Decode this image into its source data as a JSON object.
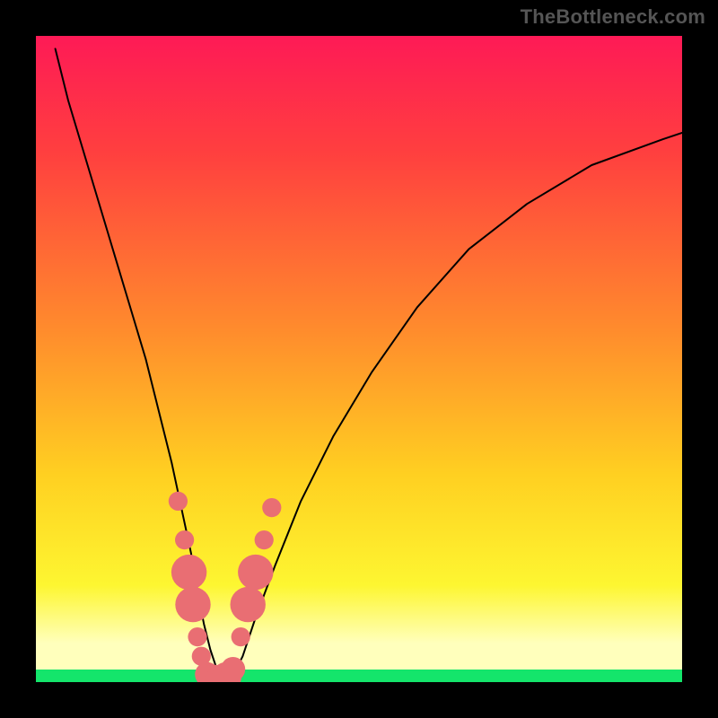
{
  "watermark": "TheBottleneck.com",
  "colors": {
    "frame": "#000000",
    "curve_stroke": "#000000",
    "marker_fill": "#e96e73",
    "bottom_band": "#14e56b",
    "grad_top": "#fe1a56",
    "grad_upper": "#ff3f3f",
    "grad_mid_upper": "#ff8a2d",
    "grad_mid": "#ffd021",
    "grad_lower": "#fdf631",
    "grad_pale": "#ffffbc"
  },
  "chart_data": {
    "type": "line",
    "title": "",
    "xlabel": "",
    "ylabel": "",
    "xlim": [
      0,
      100
    ],
    "ylim": [
      0,
      100
    ],
    "grid": false,
    "legend": false,
    "series": [
      {
        "name": "bottleneck-curve",
        "x": [
          3,
          5,
          8,
          11,
          14,
          17,
          19,
          21,
          22.5,
          24,
          25,
          26,
          27,
          28,
          29,
          30,
          32,
          34,
          37,
          41,
          46,
          52,
          59,
          67,
          76,
          86,
          97,
          100
        ],
        "y": [
          98,
          90,
          80,
          70,
          60,
          50,
          42,
          34,
          27,
          20,
          14,
          9,
          5,
          2,
          0,
          0,
          4,
          10,
          18,
          28,
          38,
          48,
          58,
          67,
          74,
          80,
          84,
          85
        ]
      }
    ],
    "markers": [
      {
        "x": 22.0,
        "y": 28,
        "r": 1.4
      },
      {
        "x": 23.0,
        "y": 22,
        "r": 1.4
      },
      {
        "x": 23.7,
        "y": 17,
        "r": 2.6
      },
      {
        "x": 24.3,
        "y": 12,
        "r": 2.6
      },
      {
        "x": 25.0,
        "y": 7,
        "r": 1.4
      },
      {
        "x": 25.6,
        "y": 4,
        "r": 1.4
      },
      {
        "x": 26.5,
        "y": 1.2,
        "r": 1.8
      },
      {
        "x": 27.5,
        "y": 0.4,
        "r": 2.2
      },
      {
        "x": 28.5,
        "y": 0.3,
        "r": 2.2
      },
      {
        "x": 29.5,
        "y": 0.8,
        "r": 2.2
      },
      {
        "x": 30.5,
        "y": 2.0,
        "r": 1.8
      },
      {
        "x": 31.7,
        "y": 7,
        "r": 1.4
      },
      {
        "x": 32.8,
        "y": 12,
        "r": 2.6
      },
      {
        "x": 34.0,
        "y": 17,
        "r": 2.6
      },
      {
        "x": 35.3,
        "y": 22,
        "r": 1.4
      },
      {
        "x": 36.5,
        "y": 27,
        "r": 1.4
      }
    ]
  }
}
